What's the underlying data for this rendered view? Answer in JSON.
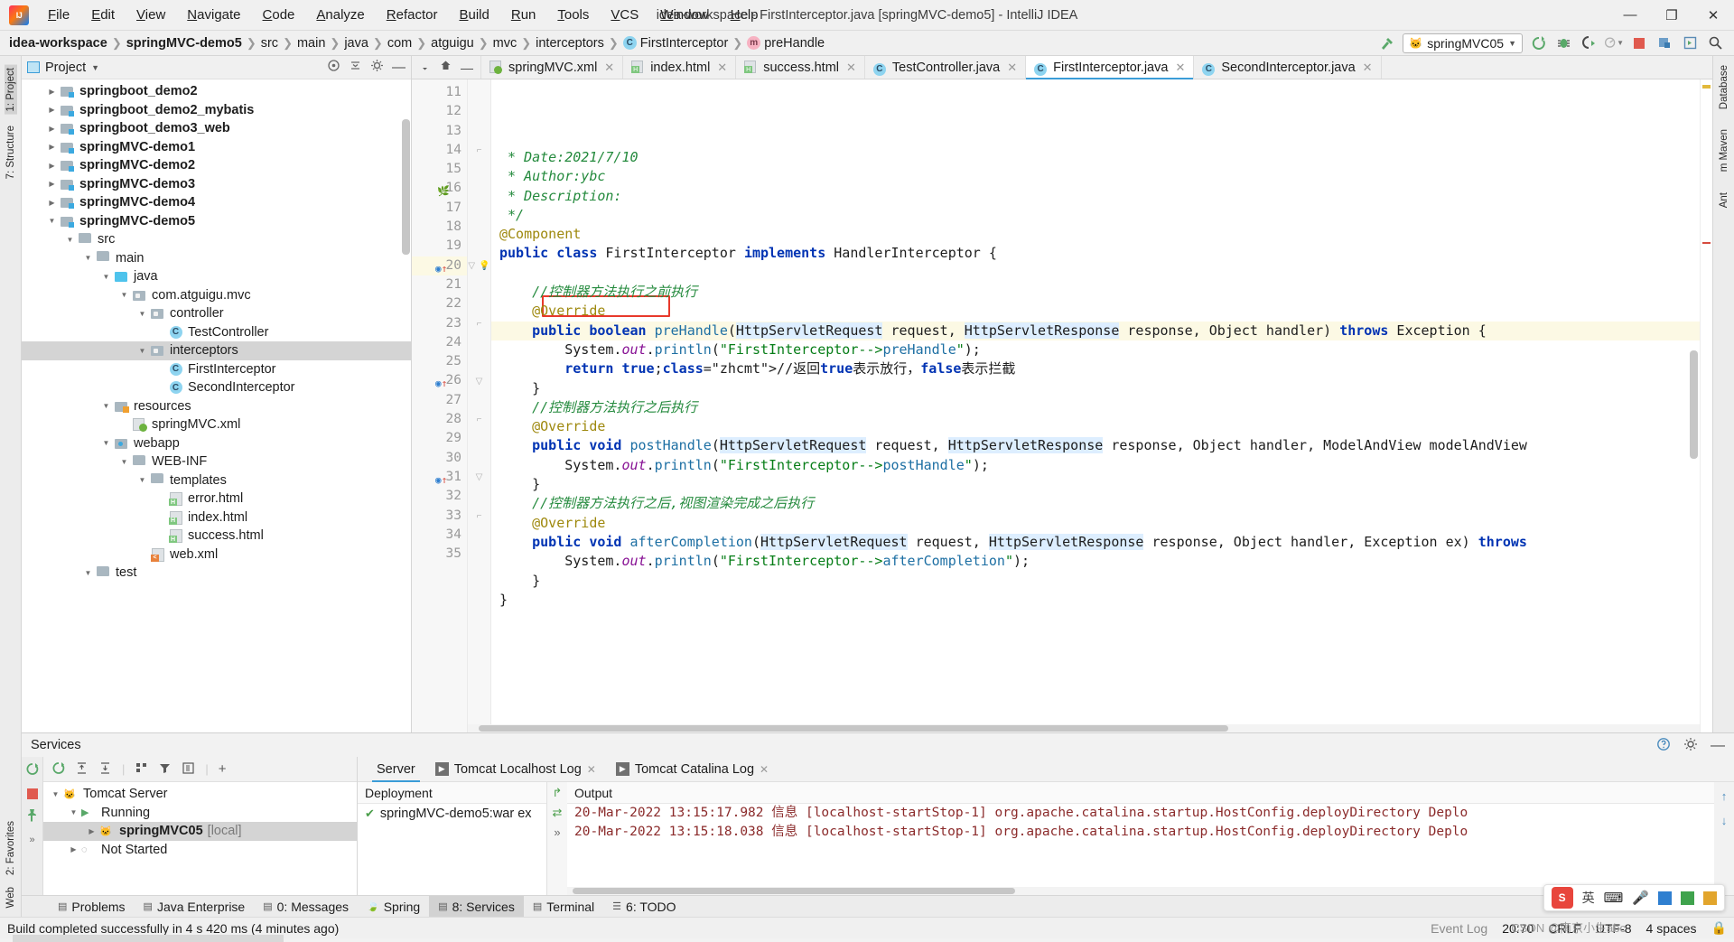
{
  "window": {
    "title": "idea-workspace - FirstInterceptor.java [springMVC-demo5] - IntelliJ IDEA",
    "minimize": "—",
    "maximize": "❐",
    "close": "✕"
  },
  "menu": [
    "File",
    "Edit",
    "View",
    "Navigate",
    "Code",
    "Analyze",
    "Refactor",
    "Build",
    "Run",
    "Tools",
    "VCS",
    "Window",
    "Help"
  ],
  "breadcrumb": [
    {
      "label": "idea-workspace",
      "bold": true,
      "icon": ""
    },
    {
      "label": "springMVC-demo5",
      "bold": true,
      "icon": ""
    },
    {
      "label": "src",
      "bold": false,
      "icon": ""
    },
    {
      "label": "main",
      "bold": false,
      "icon": ""
    },
    {
      "label": "java",
      "bold": false,
      "icon": ""
    },
    {
      "label": "com",
      "bold": false,
      "icon": ""
    },
    {
      "label": "atguigu",
      "bold": false,
      "icon": ""
    },
    {
      "label": "mvc",
      "bold": false,
      "icon": ""
    },
    {
      "label": "interceptors",
      "bold": false,
      "icon": ""
    },
    {
      "label": "FirstInterceptor",
      "bold": false,
      "icon": "class-icon"
    },
    {
      "label": "preHandle",
      "bold": false,
      "icon": "method-icon"
    }
  ],
  "toolbar": {
    "build_hammer": "build-icon",
    "run_config": "springMVC05",
    "run": "run-icon",
    "debug": "debug-icon",
    "run_coverage": "run-coverage-icon",
    "profiler": "profiler-icon",
    "stop": "stop-icon",
    "update": "update-app-icon",
    "deploy": "deploy-icon",
    "search": "search-icon"
  },
  "project_panel": {
    "title": "Project",
    "header_icons": [
      "target-icon",
      "collapse-all-icon",
      "gear-icon",
      "hide-icon"
    ],
    "tree": [
      {
        "label": "springboot_demo2",
        "indent": 1,
        "arrow": "right",
        "icon": "mod",
        "bold": true
      },
      {
        "label": "springboot_demo2_mybatis",
        "indent": 1,
        "arrow": "right",
        "icon": "mod",
        "bold": true
      },
      {
        "label": "springboot_demo3_web",
        "indent": 1,
        "arrow": "right",
        "icon": "mod",
        "bold": true
      },
      {
        "label": "springMVC-demo1",
        "indent": 1,
        "arrow": "right",
        "icon": "mod",
        "bold": true
      },
      {
        "label": "springMVC-demo2",
        "indent": 1,
        "arrow": "right",
        "icon": "mod",
        "bold": true
      },
      {
        "label": "springMVC-demo3",
        "indent": 1,
        "arrow": "right",
        "icon": "mod",
        "bold": true
      },
      {
        "label": "springMVC-demo4",
        "indent": 1,
        "arrow": "right",
        "icon": "mod",
        "bold": true
      },
      {
        "label": "springMVC-demo5",
        "indent": 1,
        "arrow": "down",
        "icon": "mod",
        "bold": true
      },
      {
        "label": "src",
        "indent": 2,
        "arrow": "down",
        "icon": "fold",
        "bold": false
      },
      {
        "label": "main",
        "indent": 3,
        "arrow": "down",
        "icon": "fold",
        "bold": false
      },
      {
        "label": "java",
        "indent": 4,
        "arrow": "down",
        "icon": "foldblue",
        "bold": false
      },
      {
        "label": "com.atguigu.mvc",
        "indent": 5,
        "arrow": "down",
        "icon": "pkg",
        "bold": false
      },
      {
        "label": "controller",
        "indent": 6,
        "arrow": "down",
        "icon": "pkg",
        "bold": false
      },
      {
        "label": "TestController",
        "indent": 7,
        "arrow": "none",
        "icon": "cls",
        "bold": false
      },
      {
        "label": "interceptors",
        "indent": 6,
        "arrow": "down",
        "icon": "pkg",
        "bold": false,
        "selected": true
      },
      {
        "label": "FirstInterceptor",
        "indent": 7,
        "arrow": "none",
        "icon": "cls",
        "bold": false
      },
      {
        "label": "SecondInterceptor",
        "indent": 7,
        "arrow": "none",
        "icon": "cls",
        "bold": false
      },
      {
        "label": "resources",
        "indent": 4,
        "arrow": "down",
        "icon": "res",
        "bold": false
      },
      {
        "label": "springMVC.xml",
        "indent": 5,
        "arrow": "none",
        "icon": "spring",
        "bold": false
      },
      {
        "label": "webapp",
        "indent": 4,
        "arrow": "down",
        "icon": "webapp",
        "bold": false
      },
      {
        "label": "WEB-INF",
        "indent": 5,
        "arrow": "down",
        "icon": "fold",
        "bold": false
      },
      {
        "label": "templates",
        "indent": 6,
        "arrow": "down",
        "icon": "fold",
        "bold": false
      },
      {
        "label": "error.html",
        "indent": 7,
        "arrow": "none",
        "icon": "html",
        "bold": false
      },
      {
        "label": "index.html",
        "indent": 7,
        "arrow": "none",
        "icon": "html",
        "bold": false
      },
      {
        "label": "success.html",
        "indent": 7,
        "arrow": "none",
        "icon": "html",
        "bold": false
      },
      {
        "label": "web.xml",
        "indent": 6,
        "arrow": "none",
        "icon": "xml",
        "bold": false
      },
      {
        "label": "test",
        "indent": 3,
        "arrow": "down",
        "icon": "fold",
        "bold": false
      }
    ]
  },
  "editor_tabs": [
    {
      "label": "springMVC.xml",
      "icon": "spring-file-icon",
      "active": false
    },
    {
      "label": "index.html",
      "icon": "html-file-icon",
      "active": false
    },
    {
      "label": "success.html",
      "icon": "html-file-icon",
      "active": false
    },
    {
      "label": "TestController.java",
      "icon": "class-icon",
      "active": false
    },
    {
      "label": "FirstInterceptor.java",
      "icon": "class-icon",
      "active": true
    },
    {
      "label": "SecondInterceptor.java",
      "icon": "class-icon",
      "active": false
    }
  ],
  "code": {
    "first_line_number": 11,
    "lines": [
      {
        "n": 11,
        "text": " * Date:2021/7/10"
      },
      {
        "n": 12,
        "text": " * Author:ybc"
      },
      {
        "n": 13,
        "text": " * Description:"
      },
      {
        "n": 14,
        "text": " */"
      },
      {
        "n": 15,
        "text": "@Component"
      },
      {
        "n": 16,
        "text": "public class FirstInterceptor implements HandlerInterceptor {"
      },
      {
        "n": 17,
        "text": ""
      },
      {
        "n": 18,
        "text": "    //控制器方法执行之前执行"
      },
      {
        "n": 19,
        "text": "    @Override"
      },
      {
        "n": 20,
        "text": "    public boolean preHandle(HttpServletRequest request, HttpServletResponse response, Object handler) throws Exception {"
      },
      {
        "n": 21,
        "text": "        System.out.println(\"FirstInterceptor-->preHandle\");"
      },
      {
        "n": 22,
        "text": "        return true;//返回true表示放行，false表示拦截"
      },
      {
        "n": 23,
        "text": "    }"
      },
      {
        "n": 24,
        "text": "    //控制器方法执行之后执行"
      },
      {
        "n": 25,
        "text": "    @Override"
      },
      {
        "n": 26,
        "text": "    public void postHandle(HttpServletRequest request, HttpServletResponse response, Object handler, ModelAndView modelAndView"
      },
      {
        "n": 27,
        "text": "        System.out.println(\"FirstInterceptor-->postHandle\");"
      },
      {
        "n": 28,
        "text": "    }"
      },
      {
        "n": 29,
        "text": "    //控制器方法执行之后,视图渲染完成之后执行"
      },
      {
        "n": 30,
        "text": "    @Override"
      },
      {
        "n": 31,
        "text": "    public void afterCompletion(HttpServletRequest request, HttpServletResponse response, Object handler, Exception ex) throws"
      },
      {
        "n": 32,
        "text": "        System.out.println(\"FirstInterceptor-->afterCompletion\");"
      },
      {
        "n": 33,
        "text": "    }"
      },
      {
        "n": 34,
        "text": "}"
      },
      {
        "n": 35,
        "text": ""
      }
    ],
    "highlight_box_line": 22,
    "highlight_box_text": "return true;"
  },
  "services": {
    "title": "Services",
    "header_icons": [
      "help-icon",
      "settings-icon",
      "hide-icon"
    ],
    "toolbar_icons": [
      "rerun-icon",
      "expand-all-icon",
      "collapse-all-icon",
      "group-icon",
      "filter-icon",
      "show-icon",
      "add-icon"
    ],
    "tree": [
      {
        "label": "Tomcat Server",
        "indent": 0,
        "arrow": "down",
        "icon": "tomcat-icon",
        "bold": false
      },
      {
        "label": "Running",
        "indent": 1,
        "arrow": "down",
        "icon": "run-green-icon",
        "bold": false
      },
      {
        "label": "springMVC05",
        "suffix": "[local]",
        "indent": 2,
        "arrow": "right",
        "icon": "tomcat-icon",
        "bold": true,
        "selected": true
      },
      {
        "label": "Not Started",
        "indent": 1,
        "arrow": "right",
        "icon": "not-started-icon",
        "bold": false
      }
    ],
    "tabs": [
      {
        "label": "Server",
        "active": true,
        "closable": false
      },
      {
        "label": "Tomcat Localhost Log",
        "active": false,
        "closable": true
      },
      {
        "label": "Tomcat Catalina Log",
        "active": false,
        "closable": true
      }
    ],
    "deployment_header": "Deployment",
    "deployment_rows": [
      {
        "label": "springMVC-demo5:war ex",
        "status": "ok"
      }
    ],
    "output_header": "Output",
    "output_lines": [
      "20-Mar-2022 13:15:17.982 信息 [localhost-startStop-1] org.apache.catalina.startup.HostConfig.deployDirectory Deplo",
      "20-Mar-2022 13:15:18.038 信息 [localhost-startStop-1] org.apache.catalina.startup.HostConfig.deployDirectory Deplo"
    ]
  },
  "tool_windows": [
    {
      "label": "Problems",
      "icon": "problems-icon",
      "selected": false
    },
    {
      "label": "Java Enterprise",
      "icon": "java-ee-icon",
      "selected": false
    },
    {
      "label": "0: Messages",
      "icon": "messages-icon",
      "selected": false
    },
    {
      "label": "Spring",
      "icon": "spring-icon",
      "selected": false
    },
    {
      "label": "8: Services",
      "icon": "services-icon",
      "selected": true
    },
    {
      "label": "Terminal",
      "icon": "terminal-icon",
      "selected": false
    },
    {
      "label": "6: TODO",
      "icon": "todo-icon",
      "selected": false
    }
  ],
  "left_rail": [
    {
      "label": "1: Project",
      "selected": true
    },
    {
      "label": "7: Structure",
      "selected": false
    },
    {
      "label": "2: Favorites",
      "selected": false
    },
    {
      "label": "Web",
      "selected": false
    }
  ],
  "right_rail": [
    "Database",
    "m Maven",
    "Ant"
  ],
  "status": {
    "message": "Build completed successfully in 4 s 420 ms (4 minutes ago)",
    "caret": "20:70",
    "line_sep": "CRLF",
    "encoding": "UTF-8",
    "indent": "4 spaces",
    "event_log": "Event Log"
  },
  "ime": {
    "logo": "S",
    "mode": "英",
    "icons": [
      "keyboard-icon",
      "mic-icon",
      "image-icon",
      "package-icon",
      "menu-icon"
    ]
  },
  "watermark": "CSDN @南京小生abc"
}
